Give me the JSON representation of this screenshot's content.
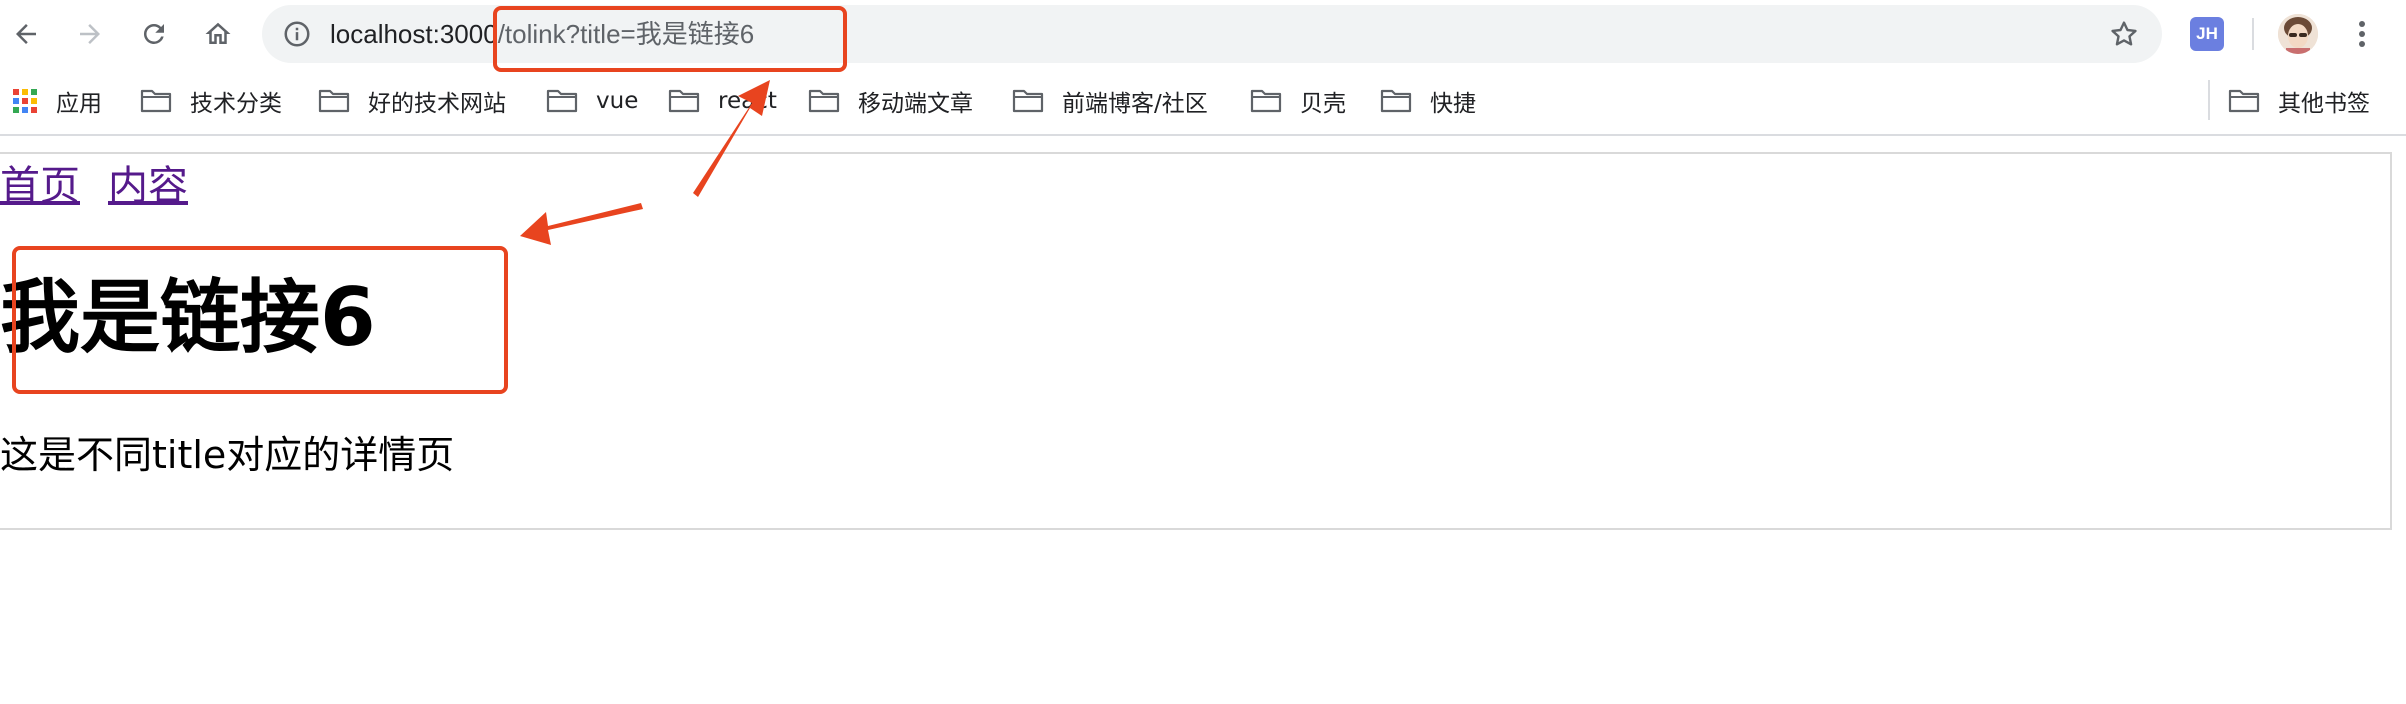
{
  "browser": {
    "url_host": "localhost:3000",
    "url_path": "/tolink?title=我是链接6",
    "extension_label": "JH",
    "icons": {
      "back": "arrow-left-icon",
      "forward": "arrow-right-icon",
      "reload": "reload-icon",
      "home": "home-icon",
      "site_info": "info-icon",
      "bookmark_star": "star-icon",
      "menu": "vertical-dots-icon"
    }
  },
  "bookmarks": {
    "apps_label": "应用",
    "items": [
      {
        "label": "技术分类"
      },
      {
        "label": "好的技术网站"
      },
      {
        "label": "vue"
      },
      {
        "label": "react"
      },
      {
        "label": "移动端文章"
      },
      {
        "label": "前端博客/社区"
      },
      {
        "label": "贝壳"
      },
      {
        "label": "快捷"
      }
    ],
    "other_label": "其他书签"
  },
  "page": {
    "nav": [
      {
        "label": "首页"
      },
      {
        "label": "内容"
      }
    ],
    "heading": "我是链接6",
    "description": "这是不同title对应的详情页"
  },
  "colors": {
    "annotation": "#e8441f",
    "visited_link": "#551a8b",
    "omnibox_bg": "#f1f3f4",
    "extension_bg": "#6b7fe0"
  }
}
